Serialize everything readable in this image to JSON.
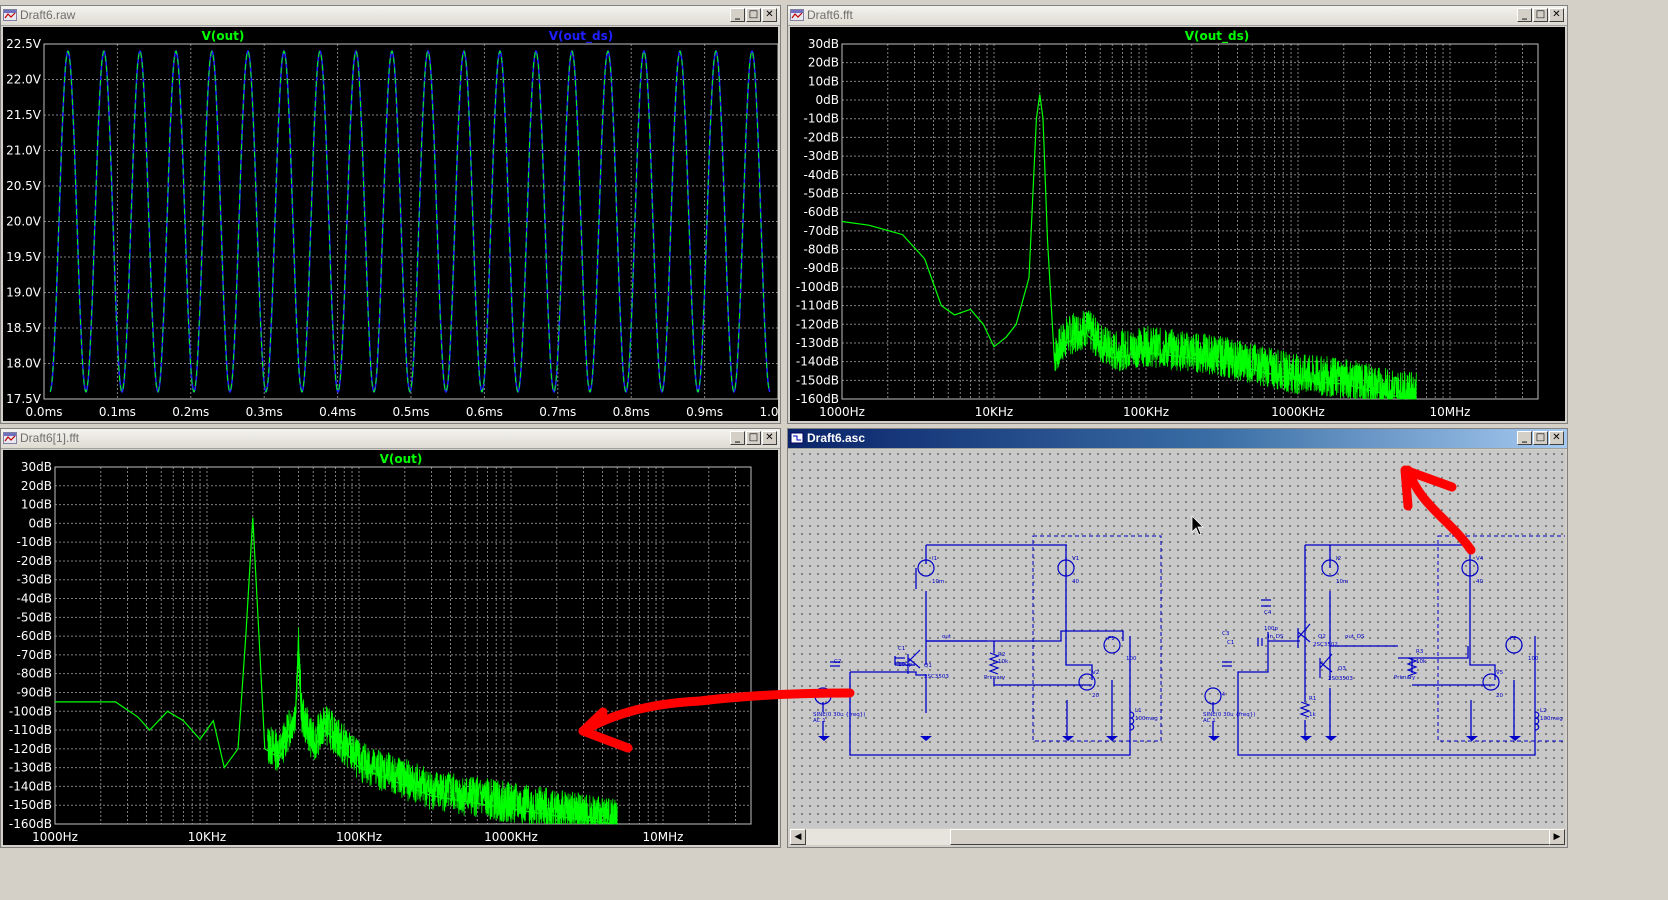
{
  "windows": {
    "raw": {
      "title": "Draft6.raw",
      "traces": [
        "V(out)",
        "V(out_ds)"
      ]
    },
    "fft": {
      "title": "Draft6.fft",
      "trace": "V(out_ds)"
    },
    "fft1": {
      "title": "Draft6[1].fft",
      "trace": "V(out)"
    },
    "asc": {
      "title": "Draft6.asc"
    }
  },
  "title_buttons": {
    "minimize": "_",
    "maximize": "□",
    "close": "✕"
  },
  "scroll_buttons": {
    "left": "◀",
    "right": "▶"
  },
  "colors": {
    "trace_green": "#00ff00",
    "trace_blue": "#2020ff",
    "axis_label": "#ffffff",
    "grid": "#808080",
    "wire": "#0000c8",
    "annotation_red": "#ff0000"
  },
  "chart_data": [
    {
      "type": "line",
      "window": "Draft6.raw",
      "series": [
        {
          "name": "V(out)"
        },
        {
          "name": "V(out_ds)"
        }
      ],
      "x_ticks": [
        "0.0ms",
        "0.1ms",
        "0.2ms",
        "0.3ms",
        "0.4ms",
        "0.5ms",
        "0.6ms",
        "0.7ms",
        "0.8ms",
        "0.9ms",
        "1.0ms"
      ],
      "y_ticks": [
        "22.5V",
        "22.0V",
        "21.5V",
        "21.0V",
        "20.5V",
        "20.0V",
        "19.5V",
        "19.0V",
        "18.5V",
        "18.0V",
        "17.5V"
      ],
      "xlim": [
        0,
        1.0
      ],
      "ylim": [
        17.5,
        22.5
      ],
      "sine": {
        "cycles": 20,
        "max": 22.4,
        "min": 17.6
      },
      "grid": true
    },
    {
      "type": "line",
      "window": "Draft6.fft",
      "series": [
        {
          "name": "V(out_ds)",
          "points": [
            [
              1000,
              -65
            ],
            [
              1500,
              -67
            ],
            [
              2500,
              -72
            ],
            [
              3500,
              -85
            ],
            [
              4500,
              -110
            ],
            [
              5500,
              -115
            ],
            [
              7000,
              -112
            ],
            [
              8500,
              -120
            ],
            [
              10000,
              -132
            ],
            [
              12000,
              -127
            ],
            [
              14000,
              -120
            ],
            [
              17000,
              -95
            ],
            [
              19000,
              -10
            ],
            [
              20000,
              3
            ],
            [
              21000,
              -10
            ],
            [
              22500,
              -75
            ],
            [
              25000,
              -140
            ],
            [
              30000,
              -130
            ],
            [
              40000,
              -125
            ],
            [
              60000,
              -138
            ],
            [
              100000,
              -135
            ],
            [
              300000,
              -140
            ],
            [
              1000000,
              -150
            ],
            [
              2000000,
              -152
            ],
            [
              4000000,
              -158
            ],
            [
              6000000,
              -160
            ]
          ]
        }
      ],
      "x_ticks": [
        "1000Hz",
        "10KHz",
        "100KHz",
        "1000KHz",
        "10MHz"
      ],
      "y_ticks": [
        "30dB",
        "20dB",
        "10dB",
        "0dB",
        "-10dB",
        "-20dB",
        "-30dB",
        "-40dB",
        "-50dB",
        "-60dB",
        "-70dB",
        "-80dB",
        "-90dB",
        "-100dB",
        "-110dB",
        "-120dB",
        "-130dB",
        "-140dB",
        "-150dB",
        "-160dB"
      ],
      "xscale": "log",
      "xlim": [
        1000,
        50000000
      ],
      "ylim": [
        -160,
        30
      ],
      "grid": true
    },
    {
      "type": "line",
      "window": "Draft6[1].fft",
      "series": [
        {
          "name": "V(out)",
          "points": [
            [
              1000,
              -95
            ],
            [
              2500,
              -95
            ],
            [
              3500,
              -103
            ],
            [
              4200,
              -110
            ],
            [
              5500,
              -100
            ],
            [
              7000,
              -105
            ],
            [
              9000,
              -115
            ],
            [
              11000,
              -105
            ],
            [
              13000,
              -130
            ],
            [
              16000,
              -120
            ],
            [
              18000,
              -60
            ],
            [
              20000,
              3
            ],
            [
              22000,
              -60
            ],
            [
              24000,
              -120
            ],
            [
              30000,
              -125
            ],
            [
              38000,
              -105
            ],
            [
              40000,
              -68
            ],
            [
              42000,
              -105
            ],
            [
              50000,
              -120
            ],
            [
              60000,
              -110
            ],
            [
              100000,
              -130
            ],
            [
              300000,
              -145
            ],
            [
              1000000,
              -152
            ],
            [
              3000000,
              -158
            ],
            [
              5000000,
              -160
            ]
          ]
        }
      ],
      "x_ticks": [
        "1000Hz",
        "10KHz",
        "100KHz",
        "1000KHz",
        "10MHz"
      ],
      "y_ticks": [
        "30dB",
        "20dB",
        "10dB",
        "0dB",
        "-10dB",
        "-20dB",
        "-30dB",
        "-40dB",
        "-50dB",
        "-60dB",
        "-70dB",
        "-80dB",
        "-90dB",
        "-100dB",
        "-110dB",
        "-120dB",
        "-130dB",
        "-140dB",
        "-150dB",
        "-160dB"
      ],
      "xscale": "log",
      "xlim": [
        1000,
        50000000
      ],
      "ylim": [
        -160,
        30
      ],
      "grid": true
    }
  ],
  "schematic": {
    "left_circuit": {
      "i_source": {
        "name": "I1",
        "value": "10m"
      },
      "v_top": {
        "name": "V1",
        "value": "40"
      },
      "capacitor": {
        "name": "C1",
        "value": "100p"
      },
      "transistor": {
        "name": "Q1",
        "model": "2SC3503"
      },
      "vs": {
        "name": "I2",
        "value": "SINE(0 30u {freq})",
        "ac": "AC 1"
      },
      "resistor": {
        "name": "R2",
        "value": "10k"
      },
      "net_out": "out",
      "label_primary": "Primary",
      "dep_source": {
        "name": "F1",
        "value": "100"
      },
      "v2": {
        "name": "V2",
        "value": "20"
      },
      "inductor": {
        "name": "L1",
        "value": "100meg"
      },
      "cap_label": "C2"
    },
    "right_circuit": {
      "i_source": {
        "name": "I2",
        "value": "10m"
      },
      "v_top": {
        "name": "V4",
        "value": "40"
      },
      "capacitor": {
        "name": "C4",
        "value": "100p"
      },
      "transistor": {
        "name": "Q2",
        "model": "2SC3502"
      },
      "transistor2": {
        "name": "Q3",
        "model": "2SC3503"
      },
      "vs": {
        "name": "I4",
        "value": "SINE(0 30u {freq})",
        "ac": "AC 1"
      },
      "resistor": {
        "name": "R3",
        "value": "10k"
      },
      "resistor2": {
        "name": "R1",
        "value": "1k"
      },
      "net_in": "in_DS",
      "net_out": "out_DS",
      "label_primary": "Primary",
      "dep_source": {
        "name": "F2",
        "value": "100"
      },
      "v2": {
        "name": "V5",
        "value": "20"
      },
      "inductor": {
        "name": "L2",
        "value": "100meg"
      },
      "cap_label": "C3",
      "cap2_label": "C1"
    }
  }
}
